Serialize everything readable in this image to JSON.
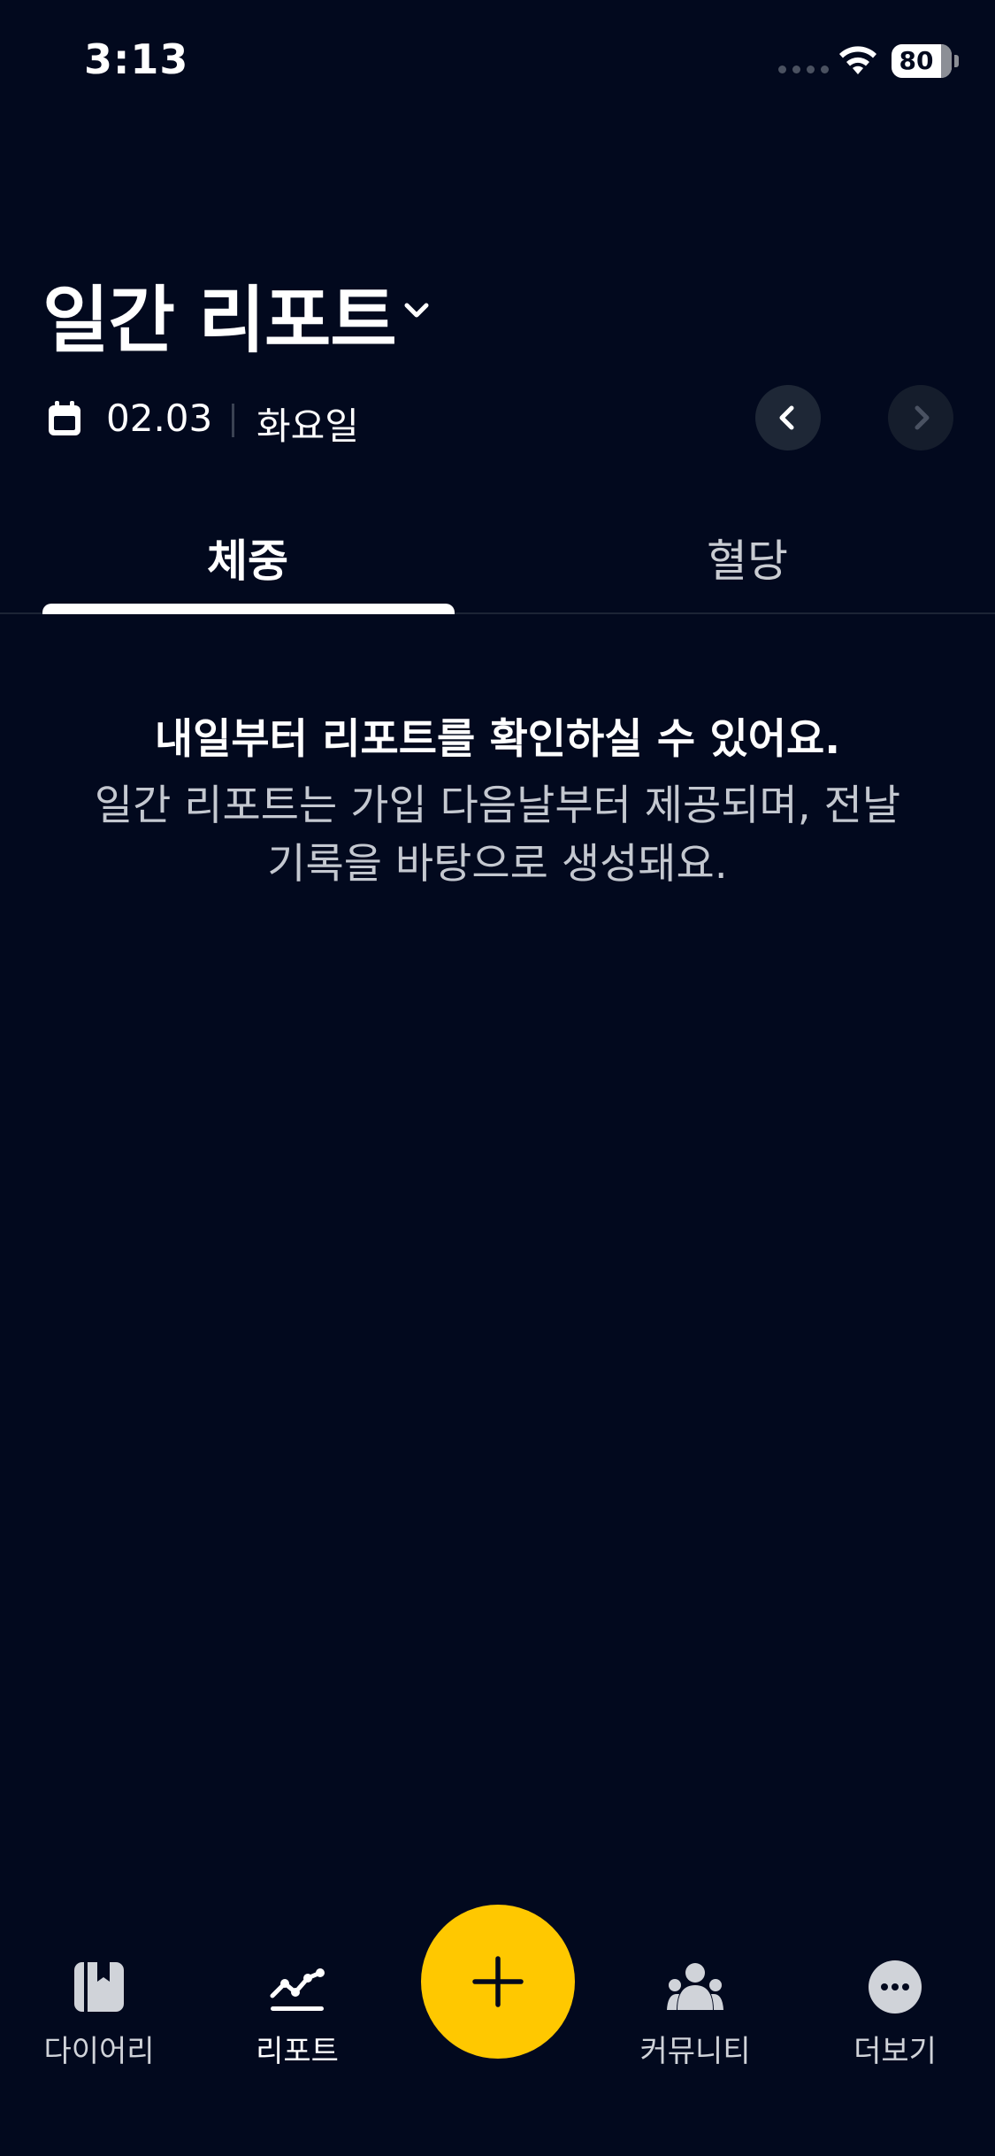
{
  "status_bar": {
    "time": "3:13",
    "battery_level": "80",
    "icons": [
      "cellular-signal-icon",
      "wifi-icon",
      "battery-icon"
    ]
  },
  "header": {
    "title": "일간 리포트",
    "title_icon": "chevron-down-icon",
    "date": "02.03",
    "weekday": "화요일",
    "date_icon": "calendar-icon",
    "prev_icon": "chevron-left-icon",
    "next_icon": "chevron-right-icon"
  },
  "tabs": [
    {
      "label": "체중",
      "active": true
    },
    {
      "label": "혈당",
      "active": false
    }
  ],
  "empty_state": {
    "title": "내일부터 리포트를 확인하실 수 있어요.",
    "description": "일간 리포트는 가입 다음날부터 제공되며, 전날 기록을 바탕으로 생성돼요."
  },
  "bottom_nav": {
    "items": [
      {
        "label": "다이어리",
        "icon": "diary-icon",
        "active": false
      },
      {
        "label": "리포트",
        "icon": "report-chart-icon",
        "active": true
      },
      {
        "label": "커뮤니티",
        "icon": "community-icon",
        "active": false
      },
      {
        "label": "더보기",
        "icon": "more-icon",
        "active": false
      }
    ],
    "fab_icon": "plus-icon"
  },
  "colors": {
    "background": "#02091E",
    "accent": "#FFC800",
    "text_primary": "#FFFFFF",
    "text_secondary": "#C4C8D0"
  }
}
